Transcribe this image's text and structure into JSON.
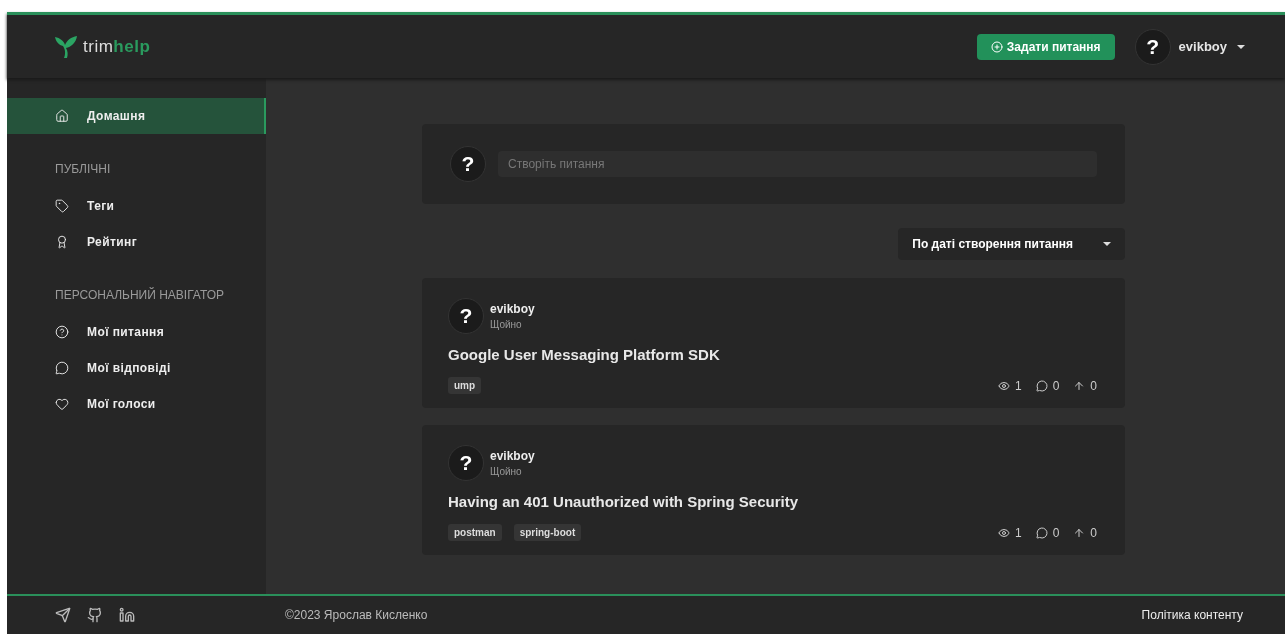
{
  "header": {
    "logo": {
      "part1": "trim",
      "part2": "help"
    },
    "ask_button": "Задати питання",
    "user": {
      "avatar": "?",
      "name": "evikboy"
    }
  },
  "sidebar": {
    "sections": [
      {
        "items": [
          {
            "label": "Домашня",
            "selected": true
          }
        ]
      },
      {
        "heading": "ПУБЛІЧНІ",
        "items": [
          {
            "label": "Теги",
            "selected": false
          },
          {
            "label": "Рейтинг",
            "selected": false
          }
        ]
      },
      {
        "heading": "ПЕРСОНАЛЬНИЙ НАВІГАТОР",
        "items": [
          {
            "label": "Мої питання",
            "selected": false
          },
          {
            "label": "Мої відповіді",
            "selected": false
          },
          {
            "label": "Мої голоси",
            "selected": false
          }
        ]
      }
    ]
  },
  "composer": {
    "avatar": "?",
    "placeholder": "Створіть питання"
  },
  "sort": {
    "value": "По даті створення питання"
  },
  "questions": [
    {
      "avatar": "?",
      "author": "evikboy",
      "time": "Щойно",
      "title": "Google User Messaging Platform SDK",
      "tags": [
        "ump"
      ],
      "views": "1",
      "answers": "0",
      "votes": "0"
    },
    {
      "avatar": "?",
      "author": "evikboy",
      "time": "Щойно",
      "title": "Having an 401 Unauthorized with Spring Security",
      "tags": [
        "postman",
        "spring-boot"
      ],
      "views": "1",
      "answers": "0",
      "votes": "0"
    }
  ],
  "footer": {
    "copyright": "©2023 Ярослав Кисленко",
    "policy_link": "Політика контенту"
  }
}
